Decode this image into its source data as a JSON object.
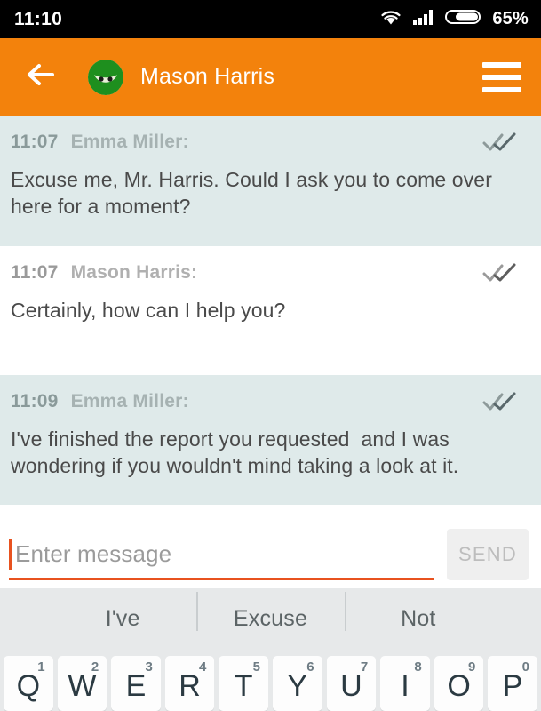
{
  "status_bar": {
    "time": "11:10",
    "battery_percent": "65%",
    "icons": [
      "wifi-icon",
      "signal-icon",
      "battery-icon"
    ]
  },
  "app_bar": {
    "back_icon": "back-arrow-icon",
    "avatar_icon": "contact-avatar-icon",
    "contact_name": "Mason Harris",
    "menu_icon": "hamburger-menu-icon",
    "background_color": "#F3820C"
  },
  "conversation": {
    "messages": [
      {
        "time": "11:07",
        "sender": "Emma Miller:",
        "text": "Excuse me, Mr. Harris. Could I ask you to come over here for a moment?",
        "direction": "in",
        "receipt": "double-check-icon"
      },
      {
        "time": "11:07",
        "sender": "Mason Harris:",
        "text": "Certainly, how can I help you?",
        "direction": "out",
        "receipt": "double-check-icon"
      },
      {
        "time": "11:09",
        "sender": "Emma Miller:",
        "text": "I've finished the report you requested  and I was wondering if you wouldn't mind taking a look at it.",
        "direction": "in",
        "receipt": "double-check-icon"
      }
    ],
    "incoming_background": "#DFEAEA",
    "outgoing_background": "#FFFFFF"
  },
  "composer": {
    "placeholder": "Enter message",
    "value": "",
    "send_label": "SEND",
    "accent_color": "#E8521F"
  },
  "suggestions": [
    "I've",
    "Excuse",
    "Not"
  ],
  "keyboard": {
    "row": [
      {
        "letter": "Q",
        "number": "1"
      },
      {
        "letter": "W",
        "number": "2"
      },
      {
        "letter": "E",
        "number": "3"
      },
      {
        "letter": "R",
        "number": "4"
      },
      {
        "letter": "T",
        "number": "5"
      },
      {
        "letter": "Y",
        "number": "6"
      },
      {
        "letter": "U",
        "number": "7"
      },
      {
        "letter": "I",
        "number": "8"
      },
      {
        "letter": "O",
        "number": "9"
      },
      {
        "letter": "P",
        "number": "0"
      }
    ]
  }
}
